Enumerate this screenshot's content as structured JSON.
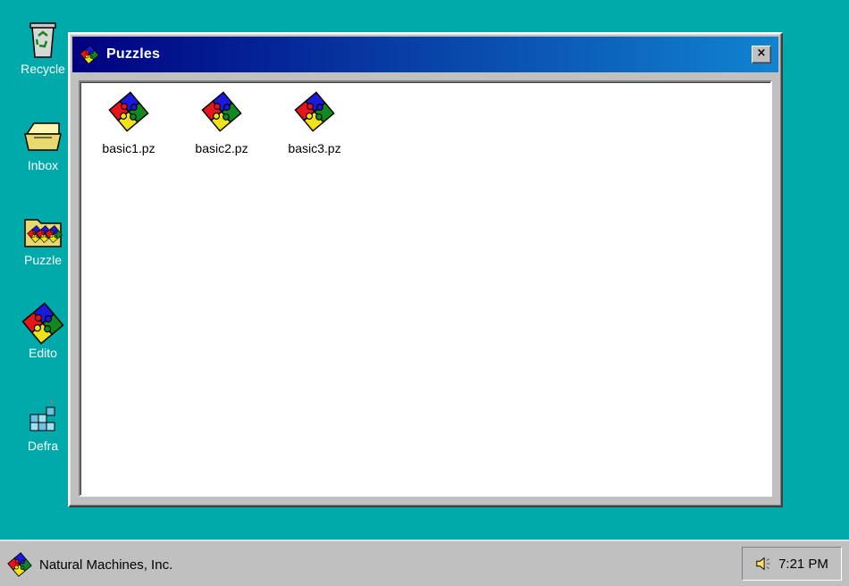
{
  "desktop": {
    "icons": [
      {
        "label": "Recycle",
        "icon": "recycle-bin-icon"
      },
      {
        "label": "Inbox",
        "icon": "inbox-icon"
      },
      {
        "label": "Puzzle",
        "icon": "puzzle-folder-icon"
      },
      {
        "label": "Edito",
        "icon": "puzzle-editor-icon"
      },
      {
        "label": "Defra",
        "icon": "defrag-icon"
      }
    ]
  },
  "window": {
    "title": "Puzzles",
    "close_glyph": "×",
    "files": [
      {
        "label": "basic1.pz",
        "icon": "puzzle-file-icon"
      },
      {
        "label": "basic2.pz",
        "icon": "puzzle-file-icon"
      },
      {
        "label": "basic3.pz",
        "icon": "puzzle-file-icon"
      }
    ]
  },
  "taskbar": {
    "start_label": "Natural Machines, Inc.",
    "clock": "7:21 PM"
  },
  "colors": {
    "desktop": "#00aaaa",
    "title_bar_start": "#000080",
    "title_bar_end": "#1084d0",
    "face": "#c0c0c0",
    "puzzle_red": "#e8141c",
    "puzzle_blue": "#1a1adc",
    "puzzle_yellow": "#f2e21a",
    "puzzle_green": "#108a20"
  }
}
